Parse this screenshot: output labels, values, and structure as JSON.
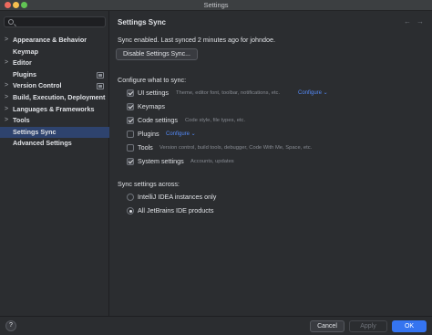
{
  "window": {
    "title": "Settings"
  },
  "search": {
    "placeholder": "",
    "value": ""
  },
  "sidebar": {
    "items": [
      {
        "label": "Appearance & Behavior",
        "expandable": true,
        "badge": false
      },
      {
        "label": "Keymap",
        "expandable": false,
        "badge": false
      },
      {
        "label": "Editor",
        "expandable": true,
        "badge": false
      },
      {
        "label": "Plugins",
        "expandable": false,
        "badge": true
      },
      {
        "label": "Version Control",
        "expandable": true,
        "badge": true
      },
      {
        "label": "Build, Execution, Deployment",
        "expandable": true,
        "badge": false
      },
      {
        "label": "Languages & Frameworks",
        "expandable": true,
        "badge": false
      },
      {
        "label": "Tools",
        "expandable": true,
        "badge": false
      },
      {
        "label": "Settings Sync",
        "expandable": false,
        "badge": false,
        "selected": true
      },
      {
        "label": "Advanced Settings",
        "expandable": false,
        "badge": false
      }
    ]
  },
  "main": {
    "title": "Settings Sync",
    "back_icon": "←",
    "forward_icon": "→",
    "status": "Sync enabled. Last synced 2 minutes ago for johndoe.",
    "disable_button": "Disable Settings Sync...",
    "configure_label": "Configure what to sync:",
    "options": [
      {
        "label": "UI settings",
        "checked": true,
        "description": "Theme, editor font, toolbar, notifications, etc.",
        "link": "Configure ⌄"
      },
      {
        "label": "Keymaps",
        "checked": true,
        "description": "",
        "link": ""
      },
      {
        "label": "Code settings",
        "checked": true,
        "description": "Code style, file types, etc.",
        "link": ""
      },
      {
        "label": "Plugins",
        "checked": false,
        "description": "",
        "link": "Configure ⌄"
      },
      {
        "label": "Tools",
        "checked": false,
        "description": "Version control, build tools, debugger, Code With Me, Space, etc.",
        "link": ""
      },
      {
        "label": "System settings",
        "checked": true,
        "description": "Accounts, updates",
        "link": ""
      }
    ],
    "across_label": "Sync settings across:",
    "across_options": [
      {
        "label": "IntelliJ IDEA instances only",
        "selected": false
      },
      {
        "label": "All JetBrains IDE products",
        "selected": true
      }
    ]
  },
  "footer": {
    "help": "?",
    "cancel": "Cancel",
    "apply": "Apply",
    "ok": "OK"
  },
  "colors": {
    "accent": "#3574f0",
    "selection": "#2e436e",
    "link": "#548af7"
  }
}
